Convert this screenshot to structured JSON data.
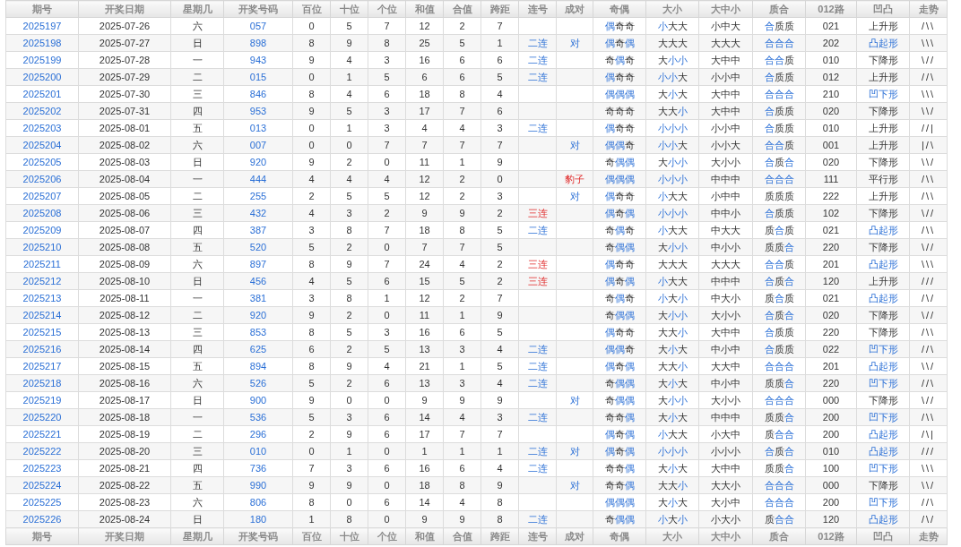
{
  "table": {
    "columns": [
      "期号",
      "开奖日期",
      "星期几",
      "开奖号码",
      "百位",
      "十位",
      "个位",
      "和值",
      "合值",
      "跨距",
      "连号",
      "成对",
      "奇偶",
      "大小",
      "大中小",
      "质合",
      "012路",
      "凹凸",
      "走势"
    ],
    "rows": [
      {
        "period": "2025197",
        "date": "2025-07-26",
        "weekday": "六",
        "number": "057",
        "hundreds": "0",
        "tens": "5",
        "units": "7",
        "sum": "12",
        "sum_tail": "2",
        "span": "7",
        "parity": "偶奇奇",
        "parity_accent": [
          true,
          false,
          false
        ],
        "size": "小大大",
        "size_accent": [
          true,
          false,
          false
        ],
        "band": "小中大",
        "prime": "合质质",
        "prime_accent": [
          true,
          false,
          false
        ],
        "route": "021",
        "shape": "上升形",
        "shape_accent": false,
        "trend": "/\\\\"
      },
      {
        "period": "2025198",
        "date": "2025-07-27",
        "weekday": "日",
        "number": "898",
        "hundreds": "8",
        "tens": "9",
        "units": "8",
        "sum": "25",
        "sum_tail": "5",
        "span": "1",
        "consec": {
          "text": "二连",
          "kind": "double"
        },
        "pair": {
          "text": "对",
          "kind": "pair"
        },
        "parity": "偶奇偶",
        "parity_accent": [
          true,
          false,
          true
        ],
        "size": "大大大",
        "size_accent": [
          false,
          false,
          false
        ],
        "band": "大大大",
        "prime": "合合合",
        "prime_accent": [
          true,
          true,
          true
        ],
        "route": "202",
        "shape": "凸起形",
        "shape_accent": true,
        "trend": "\\\\\\"
      },
      {
        "period": "2025199",
        "date": "2025-07-28",
        "weekday": "一",
        "number": "943",
        "hundreds": "9",
        "tens": "4",
        "units": "3",
        "sum": "16",
        "sum_tail": "6",
        "span": "6",
        "consec": {
          "text": "二连",
          "kind": "double"
        },
        "parity": "奇偶奇",
        "parity_accent": [
          false,
          true,
          false
        ],
        "size": "大小小",
        "size_accent": [
          false,
          true,
          true
        ],
        "band": "大中中",
        "prime": "合合质",
        "prime_accent": [
          true,
          true,
          false
        ],
        "route": "010",
        "shape": "下降形",
        "shape_accent": false,
        "trend": "\\//"
      },
      {
        "period": "2025200",
        "date": "2025-07-29",
        "weekday": "二",
        "number": "015",
        "hundreds": "0",
        "tens": "1",
        "units": "5",
        "sum": "6",
        "sum_tail": "6",
        "span": "5",
        "consec": {
          "text": "二连",
          "kind": "double"
        },
        "parity": "偶奇奇",
        "parity_accent": [
          true,
          false,
          false
        ],
        "size": "小小大",
        "size_accent": [
          true,
          true,
          false
        ],
        "band": "小小中",
        "prime": "合质质",
        "prime_accent": [
          true,
          false,
          false
        ],
        "route": "012",
        "shape": "上升形",
        "shape_accent": false,
        "trend": "//\\"
      },
      {
        "period": "2025201",
        "date": "2025-07-30",
        "weekday": "三",
        "number": "846",
        "hundreds": "8",
        "tens": "4",
        "units": "6",
        "sum": "18",
        "sum_tail": "8",
        "span": "4",
        "parity": "偶偶偶",
        "parity_accent": [
          true,
          true,
          true
        ],
        "size": "大小大",
        "size_accent": [
          false,
          true,
          false
        ],
        "band": "大中中",
        "prime": "合合合",
        "prime_accent": [
          true,
          true,
          true
        ],
        "route": "210",
        "shape": "凹下形",
        "shape_accent": true,
        "trend": "\\\\\\"
      },
      {
        "period": "2025202",
        "date": "2025-07-31",
        "weekday": "四",
        "number": "953",
        "hundreds": "9",
        "tens": "5",
        "units": "3",
        "sum": "17",
        "sum_tail": "7",
        "span": "6",
        "parity": "奇奇奇",
        "parity_accent": [
          false,
          false,
          false
        ],
        "size": "大大小",
        "size_accent": [
          false,
          false,
          true
        ],
        "band": "大中中",
        "prime": "合质质",
        "prime_accent": [
          true,
          false,
          false
        ],
        "route": "020",
        "shape": "下降形",
        "shape_accent": false,
        "trend": "\\\\/"
      },
      {
        "period": "2025203",
        "date": "2025-08-01",
        "weekday": "五",
        "number": "013",
        "hundreds": "0",
        "tens": "1",
        "units": "3",
        "sum": "4",
        "sum_tail": "4",
        "span": "3",
        "consec": {
          "text": "二连",
          "kind": "double"
        },
        "parity": "偶奇奇",
        "parity_accent": [
          true,
          false,
          false
        ],
        "size": "小小小",
        "size_accent": [
          true,
          true,
          true
        ],
        "band": "小小中",
        "prime": "合质质",
        "prime_accent": [
          true,
          false,
          false
        ],
        "route": "010",
        "shape": "上升形",
        "shape_accent": false,
        "trend": "//|"
      },
      {
        "period": "2025204",
        "date": "2025-08-02",
        "weekday": "六",
        "number": "007",
        "hundreds": "0",
        "tens": "0",
        "units": "7",
        "sum": "7",
        "sum_tail": "7",
        "span": "7",
        "pair": {
          "text": "对",
          "kind": "pair"
        },
        "parity": "偶偶奇",
        "parity_accent": [
          true,
          true,
          false
        ],
        "size": "小小大",
        "size_accent": [
          true,
          true,
          false
        ],
        "band": "小小大",
        "prime": "合合质",
        "prime_accent": [
          true,
          true,
          false
        ],
        "route": "001",
        "shape": "上升形",
        "shape_accent": false,
        "trend": "|/\\"
      },
      {
        "period": "2025205",
        "date": "2025-08-03",
        "weekday": "日",
        "number": "920",
        "hundreds": "9",
        "tens": "2",
        "units": "0",
        "sum": "11",
        "sum_tail": "1",
        "span": "9",
        "parity": "奇偶偶",
        "parity_accent": [
          false,
          true,
          true
        ],
        "size": "大小小",
        "size_accent": [
          false,
          true,
          true
        ],
        "band": "大小小",
        "prime": "合质合",
        "prime_accent": [
          true,
          false,
          true
        ],
        "route": "020",
        "shape": "下降形",
        "shape_accent": false,
        "trend": "\\\\/"
      },
      {
        "period": "2025206",
        "date": "2025-08-04",
        "weekday": "一",
        "number": "444",
        "hundreds": "4",
        "tens": "4",
        "units": "4",
        "sum": "12",
        "sum_tail": "2",
        "span": "0",
        "pair": {
          "text": "豹子",
          "kind": "triplet"
        },
        "parity": "偶偶偶",
        "parity_accent": [
          true,
          true,
          true
        ],
        "size": "小小小",
        "size_accent": [
          true,
          true,
          true
        ],
        "band": "中中中",
        "prime": "合合合",
        "prime_accent": [
          true,
          true,
          true
        ],
        "route": "111",
        "shape": "平行形",
        "shape_accent": false,
        "trend": "/\\\\"
      },
      {
        "period": "2025207",
        "date": "2025-08-05",
        "weekday": "二",
        "number": "255",
        "hundreds": "2",
        "tens": "5",
        "units": "5",
        "sum": "12",
        "sum_tail": "2",
        "span": "3",
        "pair": {
          "text": "对",
          "kind": "pair"
        },
        "parity": "偶奇奇",
        "parity_accent": [
          true,
          false,
          false
        ],
        "size": "小大大",
        "size_accent": [
          true,
          false,
          false
        ],
        "band": "小中中",
        "prime": "质质质",
        "prime_accent": [
          false,
          false,
          false
        ],
        "route": "222",
        "shape": "上升形",
        "shape_accent": false,
        "trend": "/\\\\"
      },
      {
        "period": "2025208",
        "date": "2025-08-06",
        "weekday": "三",
        "number": "432",
        "hundreds": "4",
        "tens": "3",
        "units": "2",
        "sum": "9",
        "sum_tail": "9",
        "span": "2",
        "consec": {
          "text": "三连",
          "kind": "triple"
        },
        "parity": "偶奇偶",
        "parity_accent": [
          true,
          false,
          true
        ],
        "size": "小小小",
        "size_accent": [
          true,
          true,
          true
        ],
        "band": "中中小",
        "prime": "合质质",
        "prime_accent": [
          true,
          false,
          false
        ],
        "route": "102",
        "shape": "下降形",
        "shape_accent": false,
        "trend": "\\//"
      },
      {
        "period": "2025209",
        "date": "2025-08-07",
        "weekday": "四",
        "number": "387",
        "hundreds": "3",
        "tens": "8",
        "units": "7",
        "sum": "18",
        "sum_tail": "8",
        "span": "5",
        "consec": {
          "text": "二连",
          "kind": "double"
        },
        "parity": "奇偶奇",
        "parity_accent": [
          false,
          true,
          false
        ],
        "size": "小大大",
        "size_accent": [
          true,
          false,
          false
        ],
        "band": "中大大",
        "prime": "质合质",
        "prime_accent": [
          false,
          true,
          false
        ],
        "route": "021",
        "shape": "凸起形",
        "shape_accent": true,
        "trend": "/\\\\"
      },
      {
        "period": "2025210",
        "date": "2025-08-08",
        "weekday": "五",
        "number": "520",
        "hundreds": "5",
        "tens": "2",
        "units": "0",
        "sum": "7",
        "sum_tail": "7",
        "span": "5",
        "parity": "奇偶偶",
        "parity_accent": [
          false,
          true,
          true
        ],
        "size": "大小小",
        "size_accent": [
          false,
          true,
          true
        ],
        "band": "中小小",
        "prime": "质质合",
        "prime_accent": [
          false,
          false,
          true
        ],
        "route": "220",
        "shape": "下降形",
        "shape_accent": false,
        "trend": "\\//"
      },
      {
        "period": "2025211",
        "date": "2025-08-09",
        "weekday": "六",
        "number": "897",
        "hundreds": "8",
        "tens": "9",
        "units": "7",
        "sum": "24",
        "sum_tail": "4",
        "span": "2",
        "consec": {
          "text": "三连",
          "kind": "triple"
        },
        "parity": "偶奇奇",
        "parity_accent": [
          true,
          false,
          false
        ],
        "size": "大大大",
        "size_accent": [
          false,
          false,
          false
        ],
        "band": "大大大",
        "prime": "合合质",
        "prime_accent": [
          true,
          true,
          false
        ],
        "route": "201",
        "shape": "凸起形",
        "shape_accent": true,
        "trend": "\\\\\\"
      },
      {
        "period": "2025212",
        "date": "2025-08-10",
        "weekday": "日",
        "number": "456",
        "hundreds": "4",
        "tens": "5",
        "units": "6",
        "sum": "15",
        "sum_tail": "5",
        "span": "2",
        "consec": {
          "text": "三连",
          "kind": "triple"
        },
        "parity": "偶奇偶",
        "parity_accent": [
          true,
          false,
          true
        ],
        "size": "小大大",
        "size_accent": [
          true,
          false,
          false
        ],
        "band": "中中中",
        "prime": "合质合",
        "prime_accent": [
          true,
          false,
          true
        ],
        "route": "120",
        "shape": "上升形",
        "shape_accent": false,
        "trend": "///"
      },
      {
        "period": "2025213",
        "date": "2025-08-11",
        "weekday": "一",
        "number": "381",
        "hundreds": "3",
        "tens": "8",
        "units": "1",
        "sum": "12",
        "sum_tail": "2",
        "span": "7",
        "parity": "奇偶奇",
        "parity_accent": [
          false,
          true,
          false
        ],
        "size": "小大小",
        "size_accent": [
          true,
          false,
          true
        ],
        "band": "中大小",
        "prime": "质合质",
        "prime_accent": [
          false,
          true,
          false
        ],
        "route": "021",
        "shape": "凸起形",
        "shape_accent": true,
        "trend": "/\\/"
      },
      {
        "period": "2025214",
        "date": "2025-08-12",
        "weekday": "二",
        "number": "920",
        "hundreds": "9",
        "tens": "2",
        "units": "0",
        "sum": "11",
        "sum_tail": "1",
        "span": "9",
        "parity": "奇偶偶",
        "parity_accent": [
          false,
          true,
          true
        ],
        "size": "大小小",
        "size_accent": [
          false,
          true,
          true
        ],
        "band": "大小小",
        "prime": "合质合",
        "prime_accent": [
          true,
          false,
          true
        ],
        "route": "020",
        "shape": "下降形",
        "shape_accent": false,
        "trend": "\\//"
      },
      {
        "period": "2025215",
        "date": "2025-08-13",
        "weekday": "三",
        "number": "853",
        "hundreds": "8",
        "tens": "5",
        "units": "3",
        "sum": "16",
        "sum_tail": "6",
        "span": "5",
        "parity": "偶奇奇",
        "parity_accent": [
          true,
          false,
          false
        ],
        "size": "大大小",
        "size_accent": [
          false,
          false,
          true
        ],
        "band": "大中中",
        "prime": "合质质",
        "prime_accent": [
          true,
          false,
          false
        ],
        "route": "220",
        "shape": "下降形",
        "shape_accent": false,
        "trend": "/\\\\"
      },
      {
        "period": "2025216",
        "date": "2025-08-14",
        "weekday": "四",
        "number": "625",
        "hundreds": "6",
        "tens": "2",
        "units": "5",
        "sum": "13",
        "sum_tail": "3",
        "span": "4",
        "consec": {
          "text": "二连",
          "kind": "double"
        },
        "parity": "偶偶奇",
        "parity_accent": [
          true,
          true,
          false
        ],
        "size": "大小大",
        "size_accent": [
          false,
          true,
          false
        ],
        "band": "中小中",
        "prime": "合质质",
        "prime_accent": [
          true,
          false,
          false
        ],
        "route": "022",
        "shape": "凹下形",
        "shape_accent": true,
        "trend": "//\\"
      },
      {
        "period": "2025217",
        "date": "2025-08-15",
        "weekday": "五",
        "number": "894",
        "hundreds": "8",
        "tens": "9",
        "units": "4",
        "sum": "21",
        "sum_tail": "1",
        "span": "5",
        "consec": {
          "text": "二连",
          "kind": "double"
        },
        "parity": "偶奇偶",
        "parity_accent": [
          true,
          false,
          true
        ],
        "size": "大大小",
        "size_accent": [
          false,
          false,
          true
        ],
        "band": "大大中",
        "prime": "合合合",
        "prime_accent": [
          true,
          true,
          true
        ],
        "route": "201",
        "shape": "凸起形",
        "shape_accent": true,
        "trend": "\\\\/"
      },
      {
        "period": "2025218",
        "date": "2025-08-16",
        "weekday": "六",
        "number": "526",
        "hundreds": "5",
        "tens": "2",
        "units": "6",
        "sum": "13",
        "sum_tail": "3",
        "span": "4",
        "consec": {
          "text": "二连",
          "kind": "double"
        },
        "parity": "奇偶偶",
        "parity_accent": [
          false,
          true,
          true
        ],
        "size": "大小大",
        "size_accent": [
          false,
          true,
          false
        ],
        "band": "中小中",
        "prime": "质质合",
        "prime_accent": [
          false,
          false,
          true
        ],
        "route": "220",
        "shape": "凹下形",
        "shape_accent": true,
        "trend": "//\\"
      },
      {
        "period": "2025219",
        "date": "2025-08-17",
        "weekday": "日",
        "number": "900",
        "hundreds": "9",
        "tens": "0",
        "units": "0",
        "sum": "9",
        "sum_tail": "9",
        "span": "9",
        "pair": {
          "text": "对",
          "kind": "pair"
        },
        "parity": "奇偶偶",
        "parity_accent": [
          false,
          true,
          true
        ],
        "size": "大小小",
        "size_accent": [
          false,
          true,
          true
        ],
        "band": "大小小",
        "prime": "合合合",
        "prime_accent": [
          true,
          true,
          true
        ],
        "route": "000",
        "shape": "下降形",
        "shape_accent": false,
        "trend": "\\//"
      },
      {
        "period": "2025220",
        "date": "2025-08-18",
        "weekday": "一",
        "number": "536",
        "hundreds": "5",
        "tens": "3",
        "units": "6",
        "sum": "14",
        "sum_tail": "4",
        "span": "3",
        "consec": {
          "text": "二连",
          "kind": "double"
        },
        "parity": "奇奇偶",
        "parity_accent": [
          false,
          false,
          true
        ],
        "size": "大小大",
        "size_accent": [
          false,
          true,
          false
        ],
        "band": "中中中",
        "prime": "质质合",
        "prime_accent": [
          false,
          false,
          true
        ],
        "route": "200",
        "shape": "凹下形",
        "shape_accent": true,
        "trend": "/\\\\"
      },
      {
        "period": "2025221",
        "date": "2025-08-19",
        "weekday": "二",
        "number": "296",
        "hundreds": "2",
        "tens": "9",
        "units": "6",
        "sum": "17",
        "sum_tail": "7",
        "span": "7",
        "parity": "偶奇偶",
        "parity_accent": [
          true,
          false,
          true
        ],
        "size": "小大大",
        "size_accent": [
          true,
          false,
          false
        ],
        "band": "小大中",
        "prime": "质合合",
        "prime_accent": [
          false,
          true,
          true
        ],
        "route": "200",
        "shape": "凸起形",
        "shape_accent": true,
        "trend": "/\\|"
      },
      {
        "period": "2025222",
        "date": "2025-08-20",
        "weekday": "三",
        "number": "010",
        "hundreds": "0",
        "tens": "1",
        "units": "0",
        "sum": "1",
        "sum_tail": "1",
        "span": "1",
        "consec": {
          "text": "二连",
          "kind": "double"
        },
        "pair": {
          "text": "对",
          "kind": "pair"
        },
        "parity": "偶奇偶",
        "parity_accent": [
          true,
          false,
          true
        ],
        "size": "小小小",
        "size_accent": [
          true,
          true,
          true
        ],
        "band": "小小小",
        "prime": "合质合",
        "prime_accent": [
          true,
          false,
          true
        ],
        "route": "010",
        "shape": "凸起形",
        "shape_accent": true,
        "trend": "///"
      },
      {
        "period": "2025223",
        "date": "2025-08-21",
        "weekday": "四",
        "number": "736",
        "hundreds": "7",
        "tens": "3",
        "units": "6",
        "sum": "16",
        "sum_tail": "6",
        "span": "4",
        "consec": {
          "text": "二连",
          "kind": "double"
        },
        "parity": "奇奇偶",
        "parity_accent": [
          false,
          false,
          true
        ],
        "size": "大小大",
        "size_accent": [
          false,
          true,
          false
        ],
        "band": "大中中",
        "prime": "质质合",
        "prime_accent": [
          false,
          false,
          true
        ],
        "route": "100",
        "shape": "凹下形",
        "shape_accent": true,
        "trend": "\\\\\\"
      },
      {
        "period": "2025224",
        "date": "2025-08-22",
        "weekday": "五",
        "number": "990",
        "hundreds": "9",
        "tens": "9",
        "units": "0",
        "sum": "18",
        "sum_tail": "8",
        "span": "9",
        "pair": {
          "text": "对",
          "kind": "pair"
        },
        "parity": "奇奇偶",
        "parity_accent": [
          false,
          false,
          true
        ],
        "size": "大大小",
        "size_accent": [
          false,
          false,
          true
        ],
        "band": "大大小",
        "prime": "合合合",
        "prime_accent": [
          true,
          true,
          true
        ],
        "route": "000",
        "shape": "下降形",
        "shape_accent": false,
        "trend": "\\\\/"
      },
      {
        "period": "2025225",
        "date": "2025-08-23",
        "weekday": "六",
        "number": "806",
        "hundreds": "8",
        "tens": "0",
        "units": "6",
        "sum": "14",
        "sum_tail": "4",
        "span": "8",
        "parity": "偶偶偶",
        "parity_accent": [
          true,
          true,
          true
        ],
        "size": "大小大",
        "size_accent": [
          false,
          true,
          false
        ],
        "band": "大小中",
        "prime": "合合合",
        "prime_accent": [
          true,
          true,
          true
        ],
        "route": "200",
        "shape": "凹下形",
        "shape_accent": true,
        "trend": "//\\"
      },
      {
        "period": "2025226",
        "date": "2025-08-24",
        "weekday": "日",
        "number": "180",
        "hundreds": "1",
        "tens": "8",
        "units": "0",
        "sum": "9",
        "sum_tail": "9",
        "span": "8",
        "consec": {
          "text": "二连",
          "kind": "double"
        },
        "parity": "奇偶偶",
        "parity_accent": [
          false,
          true,
          true
        ],
        "size": "小大小",
        "size_accent": [
          true,
          false,
          true
        ],
        "band": "小大小",
        "prime": "质合合",
        "prime_accent": [
          false,
          true,
          true
        ],
        "route": "120",
        "shape": "凸起形",
        "shape_accent": true,
        "trend": "/\\/"
      }
    ],
    "footer": [
      "期号",
      "开奖日期",
      "星期几",
      "开奖号码",
      "百位",
      "十位",
      "个位",
      "和值",
      "合值",
      "跨距",
      "连号",
      "成对",
      "奇偶",
      "大小",
      "大中小",
      "质合",
      "012路",
      "凹凸",
      "走势"
    ]
  }
}
